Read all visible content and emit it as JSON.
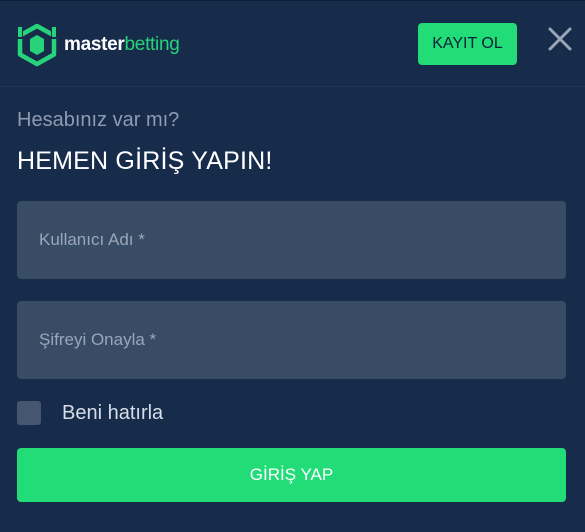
{
  "brand": {
    "name_part1": "master",
    "name_part2": "betting",
    "accent_color": "#22dc78"
  },
  "header": {
    "signup_label": "KAYIT OL",
    "close_icon": "close-icon"
  },
  "login": {
    "subtitle": "Hesabınız var mı?",
    "title": "HEMEN GİRİŞ YAPIN!",
    "username_placeholder": "Kullanıcı Adı *",
    "username_value": "",
    "password_placeholder": "Şifreyi Onayla *",
    "password_value": "",
    "remember_label": "Beni hatırla",
    "remember_checked": false,
    "submit_label": "GİRİŞ YAP"
  }
}
